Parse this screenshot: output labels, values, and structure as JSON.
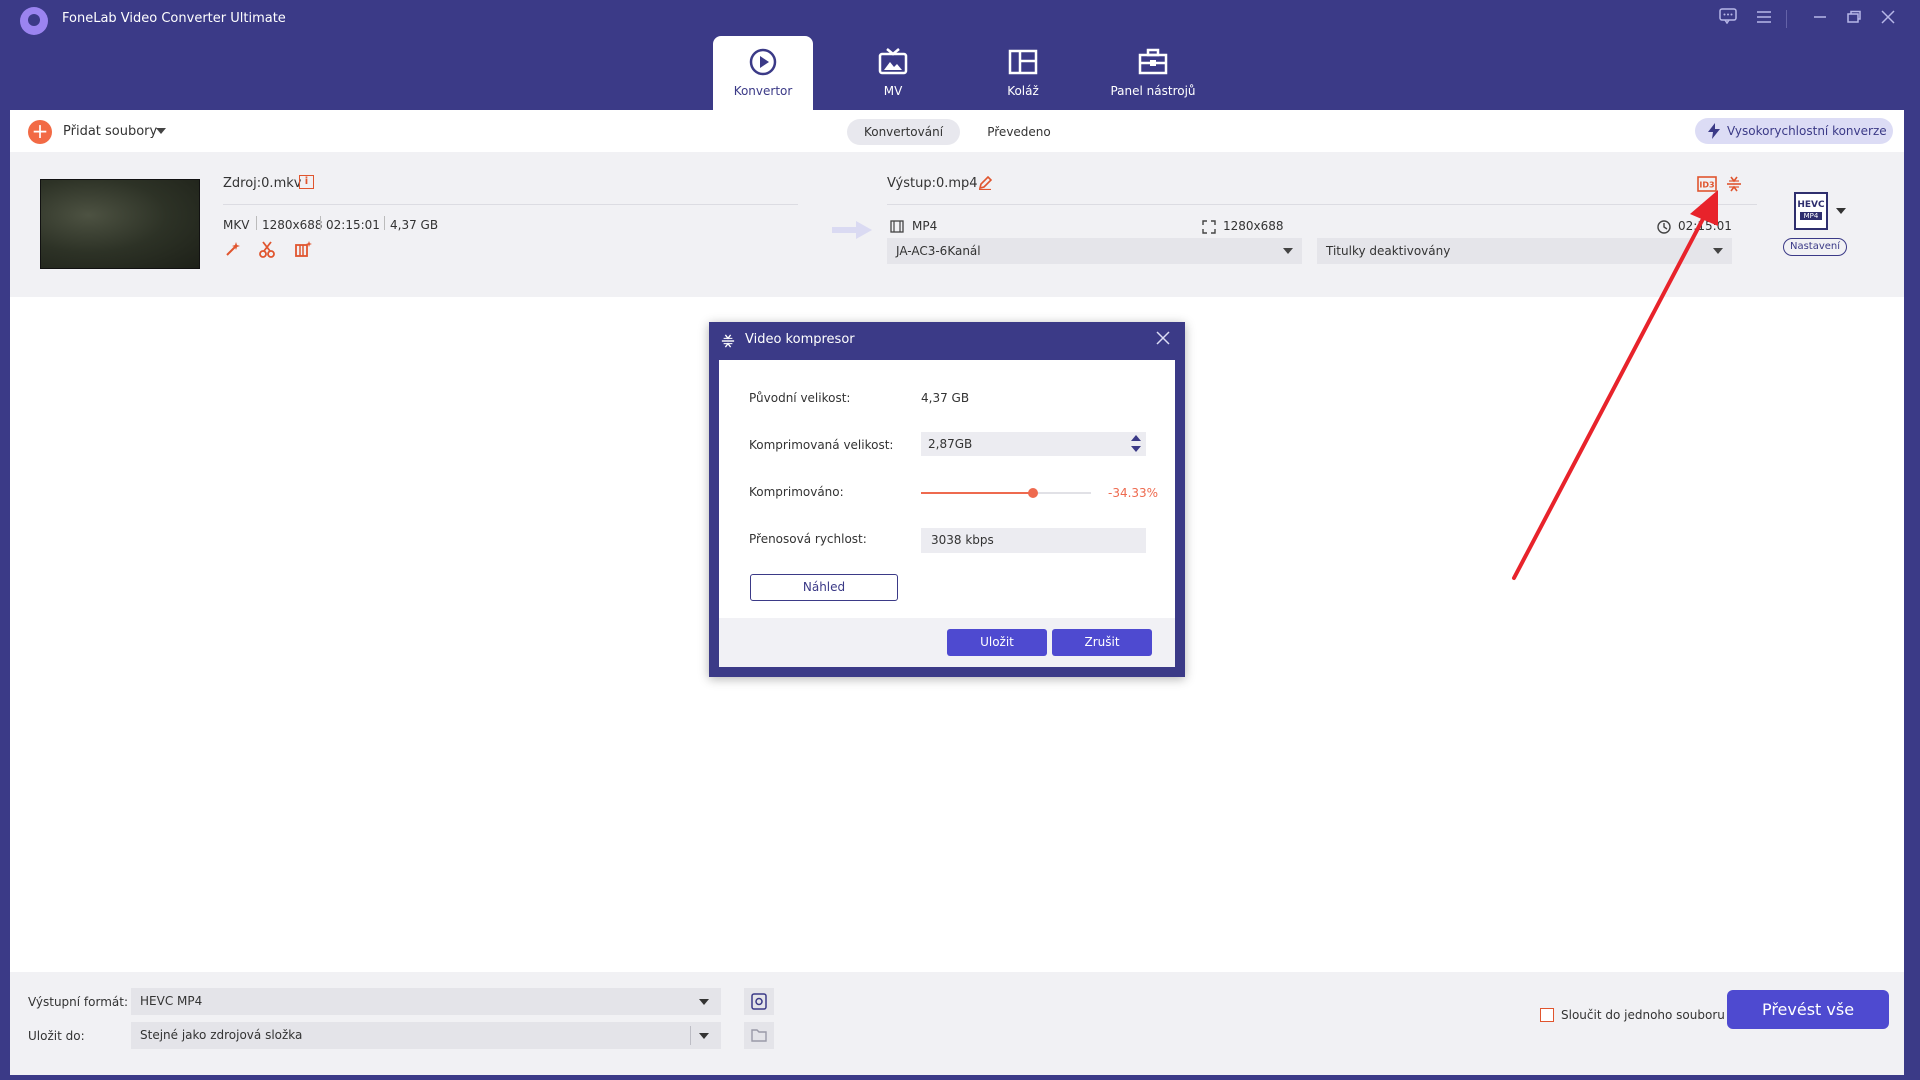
{
  "app": {
    "title": "FoneLab Video Converter Ultimate"
  },
  "main_tabs": [
    {
      "label": "Konvertor",
      "icon": "converter-icon",
      "active": true
    },
    {
      "label": "MV",
      "icon": "tv-icon",
      "active": false
    },
    {
      "label": "Koláž",
      "icon": "collage-icon",
      "active": false
    },
    {
      "label": "Panel nástrojů",
      "icon": "toolbox-icon",
      "active": false
    }
  ],
  "toolbar": {
    "add_files_label": "Přidat soubory",
    "sub_tabs": [
      "Konvertování",
      "Převedeno"
    ],
    "active_sub_tab": "Konvertování",
    "fast_conversion_label": "Vysokorychlostní konverze"
  },
  "file": {
    "source_name": "Zdroj:0.mkv",
    "source_format": "MKV",
    "source_resolution": "1280x688",
    "source_duration": "02:15:01",
    "source_size": "4,37 GB",
    "output_name": "Výstup:0.mp4",
    "output_format": "MP4",
    "output_resolution": "1280x688",
    "output_duration": "02:15:01",
    "audio_track": "JA-AC3-6Kanál",
    "subtitles": "Titulky deaktivovány",
    "badge_top": "HEVC",
    "badge_bottom": "MP4",
    "settings_label": "Nastavení"
  },
  "dialog": {
    "title": "Video kompresor",
    "original_size_label": "Původní velikost:",
    "original_size_value": "4,37 GB",
    "compressed_size_label": "Komprimovaná velikost:",
    "compressed_size_value": "2,87GB",
    "compressed_label": "Komprimováno:",
    "compressed_percent": "-34.33%",
    "slider_fraction": 0.6567,
    "bitrate_label": "Přenosová rychlost:",
    "bitrate_value": "3038 kbps",
    "preview_label": "Náhled",
    "save_label": "Uložit",
    "cancel_label": "Zrušit"
  },
  "bottom": {
    "output_format_label": "Výstupní formát:",
    "output_format_value": "HEVC MP4",
    "save_to_label": "Uložit do:",
    "save_to_value": "Stejné jako zdrojová složka",
    "merge_label": "Sloučit do jednoho souboru",
    "convert_all_label": "Převést vše"
  },
  "colors": {
    "brand": "#3b3a87",
    "accent": "#4e4ad0",
    "orange": "#ee6a4f",
    "annotation_red": "#e8232b"
  }
}
